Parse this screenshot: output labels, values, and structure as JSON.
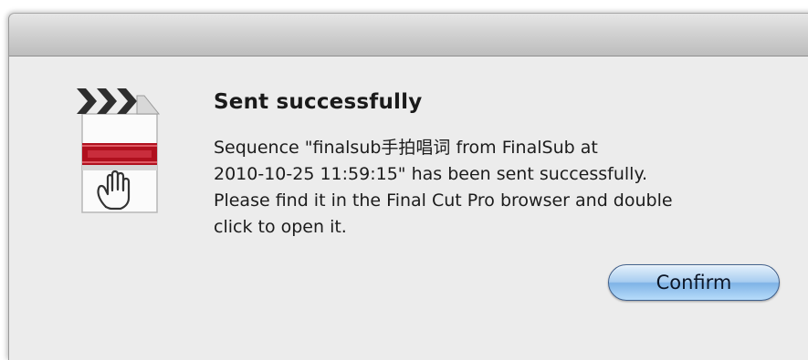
{
  "dialog": {
    "title": "Sent successfully",
    "message_lines": [
      "Sequence \"finalsub手拍唱词 from FinalSub at",
      "2010-10-25 11:59:15\" has been sent successfully.",
      "Please find it in the Final Cut Pro browser and double",
      "click to open it."
    ],
    "confirm_label": "Confirm"
  },
  "icons": {
    "app_icon": "final-cut-pro-document-icon"
  },
  "colors": {
    "window_bg": "#ececec",
    "button_accent": "#7fb3e6",
    "icon_red": "#b0101e"
  }
}
